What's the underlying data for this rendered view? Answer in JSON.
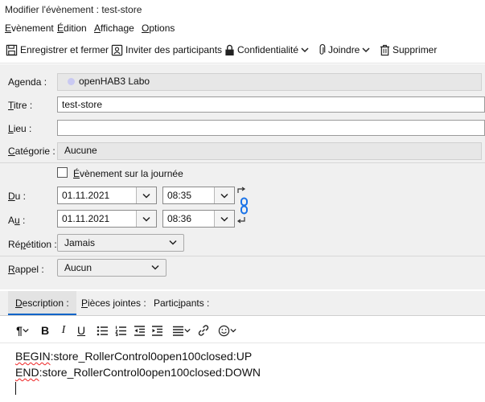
{
  "window": {
    "title": "Modifier l'évènement : test-store"
  },
  "menu": [
    {
      "key": "E",
      "rest": "vènement"
    },
    {
      "key": "É",
      "rest": "dition"
    },
    {
      "key": "A",
      "rest": "ffichage"
    },
    {
      "key": "O",
      "rest": "ptions"
    }
  ],
  "toolbar": {
    "save_label": "Enregistrer et fermer",
    "invite_label": "Inviter des participants",
    "privacy_label": "Confidentialité",
    "attach_label": "Joindre",
    "delete_label": "Supprimer"
  },
  "form": {
    "agenda_label": "Agenda :",
    "agenda_value": "openHAB3 Labo",
    "agenda_color": "#c9c9f2",
    "title_label": "Titre :",
    "title_value": "test-store",
    "location_label": "Lieu :",
    "location_value": "",
    "category_label": "Catégorie :",
    "category_value": "Aucune",
    "allday_label": "Évènement sur la journée",
    "from_label": "Du :",
    "from_date": "01.11.2021",
    "from_time": "08:35",
    "to_label": "Au :",
    "to_date": "01.11.2021",
    "to_time": "08:36",
    "repeat_label": "Répétition :",
    "repeat_value": "Jamais",
    "reminder_label": "Rappel :",
    "reminder_value": "Aucun"
  },
  "tabs": [
    {
      "label": "Description :",
      "active": true
    },
    {
      "label": "Pièces jointes :",
      "active": false
    },
    {
      "label": "Participants :",
      "active": false
    }
  ],
  "editor": {
    "line1_prefix": "BEGIN",
    "line1_rest": ":store_RollerControl0open100closed:UP",
    "line2_prefix": "END",
    "line2_rest": ":store_RollerControl0open100closed:DOWN"
  },
  "colors": {
    "link_icon": "#1a73e8",
    "tab_accent": "#0a64c8"
  }
}
